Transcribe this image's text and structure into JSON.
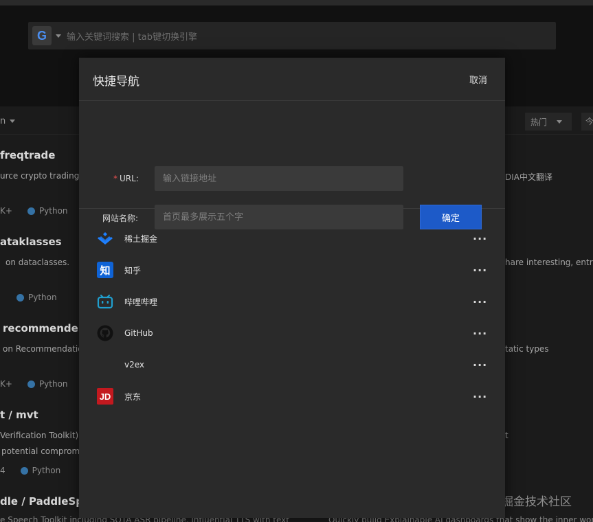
{
  "search": {
    "placeholder": "输入关键词搜索 | tab键切换引擎",
    "engine_logo": "G"
  },
  "filters": {
    "hot_label": "热门",
    "extra_label": "今"
  },
  "background": {
    "repos": [
      {
        "title": "freqtrade",
        "desc": "urce crypto trading b",
        "meta_prefix": "K+",
        "lang": "Python"
      },
      {
        "title": "ataklasses",
        "desc": "on dataclasses.",
        "meta_prefix": "",
        "lang": "Python"
      },
      {
        "title": "recommenders",
        "desc": "on Recommendation",
        "meta_prefix": "K+",
        "lang": "Python"
      },
      {
        "title": "t / mvt",
        "desc": "Verification Toolkit) h",
        "desc2": "potential compromi",
        "meta_prefix": "4",
        "lang": "Python"
      },
      {
        "title": "dle / PaddleSpe",
        "desc": "e Speech Toolkit including SOTA ASR pipeline, influential TTS with text",
        "meta_prefix": "",
        "lang": ""
      }
    ],
    "right_snippets": [
      "DIA中文翻译",
      "hare interesting, entry",
      "tatic types",
      "t"
    ],
    "bottom_right": "Quickly build Explainable AI dashboards that show the inner worki"
  },
  "modal": {
    "title": "快捷导航",
    "cancel_label": "取消",
    "form": {
      "url_label": "URL:",
      "url_placeholder": "输入链接地址",
      "name_label": "网站名称:",
      "name_placeholder": "首页最多展示五个字",
      "confirm_label": "确定"
    },
    "links": [
      {
        "name": "稀土掘金",
        "icon": "juejin-icon"
      },
      {
        "name": "知乎",
        "icon": "zhihu-icon",
        "glyph": "知"
      },
      {
        "name": "哔哩哔哩",
        "icon": "bilibili-icon"
      },
      {
        "name": "GitHub",
        "icon": "github-icon"
      },
      {
        "name": "v2ex",
        "icon": "v2ex-icon"
      },
      {
        "name": "京东",
        "icon": "jd-icon",
        "glyph": "JD"
      }
    ],
    "more_label": "···"
  },
  "watermark": "@稀土掘金技术社区",
  "colors": {
    "accent": "#1d5ac8",
    "required": "#e34f4f",
    "python_dot": "#3572a5"
  }
}
